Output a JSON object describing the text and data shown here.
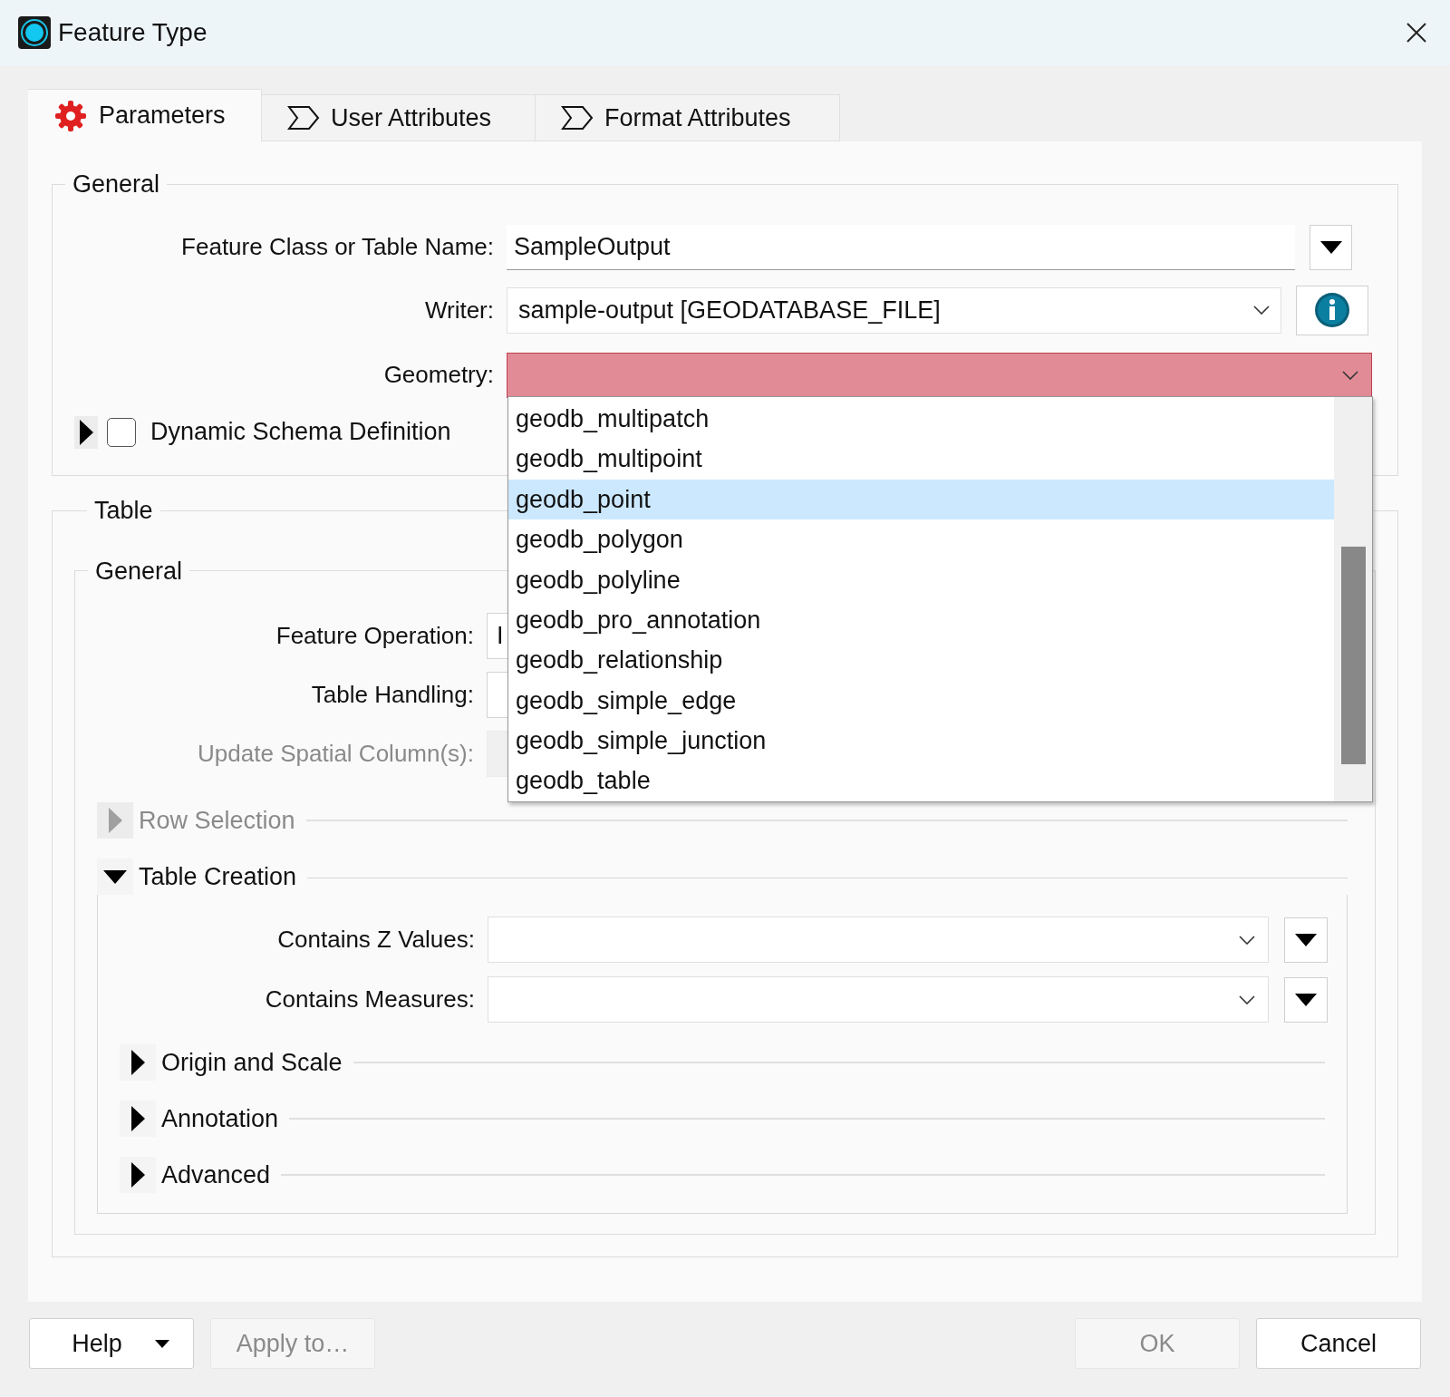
{
  "window": {
    "title": "Feature Type"
  },
  "tabs": [
    {
      "label": "Parameters",
      "kind": "gear",
      "selected": true
    },
    {
      "label": "User Attributes",
      "kind": "chevron",
      "selected": false
    },
    {
      "label": "Format Attributes",
      "kind": "chevron",
      "selected": false
    }
  ],
  "general": {
    "title": "General",
    "feature_class": {
      "label": "Feature Class or Table Name:",
      "value": "SampleOutput"
    },
    "writer": {
      "label": "Writer:",
      "value": "sample-output [GEODATABASE_FILE]"
    },
    "geometry": {
      "label": "Geometry:",
      "invalid": true
    },
    "dynamic_schema": {
      "label": "Dynamic Schema Definition",
      "checked": false,
      "expanded": false
    }
  },
  "geometry_dropdown": {
    "options": [
      {
        "label": "geodb_multipatch",
        "selected": false
      },
      {
        "label": "geodb_multipoint",
        "selected": false
      },
      {
        "label": "geodb_point",
        "selected": true
      },
      {
        "label": "geodb_polygon",
        "selected": false
      },
      {
        "label": "geodb_polyline",
        "selected": false
      },
      {
        "label": "geodb_pro_annotation",
        "selected": false
      },
      {
        "label": "geodb_relationship",
        "selected": false
      },
      {
        "label": "geodb_simple_edge",
        "selected": false
      },
      {
        "label": "geodb_simple_junction",
        "selected": false
      },
      {
        "label": "geodb_table",
        "selected": false
      }
    ]
  },
  "table": {
    "title": "Table",
    "general": {
      "title": "General",
      "fields": [
        {
          "label": "Feature Operation:",
          "value": "I",
          "disabled": false
        },
        {
          "label": "Table Handling:",
          "disabled": false
        },
        {
          "label": "Update Spatial Column(s):",
          "disabled": true
        }
      ]
    },
    "row_selection": {
      "label": "Row Selection",
      "expanded": false,
      "disabled": true
    },
    "table_creation": {
      "label": "Table Creation",
      "expanded": true,
      "fields": [
        {
          "label": "Contains Z Values:"
        },
        {
          "label": "Contains Measures:"
        }
      ],
      "sections": [
        {
          "label": "Origin and Scale",
          "expanded": false
        },
        {
          "label": "Annotation",
          "expanded": false
        },
        {
          "label": "Advanced",
          "expanded": false
        }
      ]
    }
  },
  "buttons": [
    {
      "label": "Help",
      "kind": "split",
      "disabled": false
    },
    {
      "label": "Apply to…",
      "kind": "plain",
      "disabled": true
    },
    {
      "label": "OK",
      "kind": "plain",
      "disabled": true
    },
    {
      "label": "Cancel",
      "kind": "plain",
      "disabled": false
    }
  ]
}
